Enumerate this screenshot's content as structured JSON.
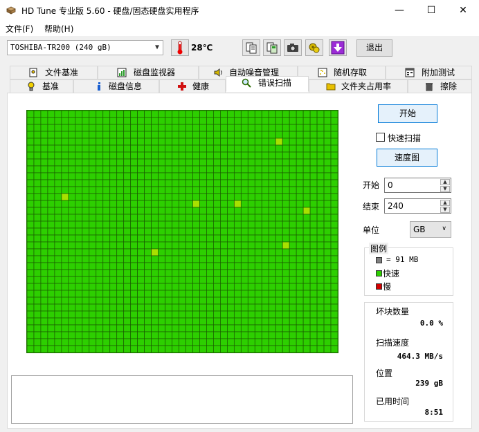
{
  "window": {
    "title": "HD Tune 专业版 5.60 - 硬盘/固态硬盘实用程序",
    "minimize_glyph": "—",
    "maximize_glyph": "☐",
    "close_glyph": "✕"
  },
  "menu": [
    {
      "label": "文件(F)"
    },
    {
      "label": "帮助(H)"
    }
  ],
  "toolbar": {
    "drive": "TOSHIBA-TR200 (240 gB)",
    "temperature": "28℃",
    "exit_label": "退出",
    "icons": [
      "copy-info-icon",
      "copy-all-icon",
      "screenshot-camera-icon",
      "options-icon",
      "download-icon"
    ]
  },
  "tabs_top": [
    {
      "label": "文件基准",
      "icon": "file-benchmark-icon"
    },
    {
      "label": "磁盘监视器",
      "icon": "disk-monitor-icon"
    },
    {
      "label": "自动噪音管理",
      "icon": "noise-speaker-icon"
    },
    {
      "label": "随机存取",
      "icon": "random-access-icon"
    },
    {
      "label": "附加测试",
      "icon": "extra-tests-icon"
    }
  ],
  "tabs_bottom": [
    {
      "label": "基准",
      "icon": "benchmark-icon"
    },
    {
      "label": "磁盘信息",
      "icon": "info-icon"
    },
    {
      "label": "健康",
      "icon": "health-cross-icon"
    },
    {
      "label": "错误扫描",
      "icon": "magnifier-icon",
      "active": true
    },
    {
      "label": "文件夹占用率",
      "icon": "folder-icon"
    },
    {
      "label": "擦除",
      "icon": "trash-icon"
    }
  ],
  "scan": {
    "grid_cols": 45,
    "grid_rows": 35,
    "fast_color": "#2dcf00",
    "slow_color": "#d40000",
    "light_blocks": [
      [
        36,
        4
      ],
      [
        5,
        12
      ],
      [
        24,
        13
      ],
      [
        30,
        13
      ],
      [
        40,
        14
      ],
      [
        37,
        19
      ],
      [
        18,
        20
      ]
    ]
  },
  "controls": {
    "start_button": "开始",
    "quick_scan_label": "快速扫描",
    "quick_scan_checked": false,
    "speed_map_button": "速度图",
    "start_label": "开始",
    "start_value": "0",
    "end_label": "结束",
    "end_value": "240",
    "unit_label": "单位",
    "unit_value": "GB"
  },
  "legend": {
    "title": "图例",
    "block_size": "= 91 MB",
    "block_color": "#808080",
    "fast_label": "快速",
    "fast_color": "#2dcf00",
    "slow_label": "慢",
    "slow_color": "#d40000"
  },
  "stats": {
    "bad_blocks_label": "坏块数量",
    "bad_blocks_value": "0.0 %",
    "scan_speed_label": "扫描速度",
    "scan_speed_value": "464.3 MB/s",
    "position_label": "位置",
    "position_value": "239 gB",
    "elapsed_label": "已用时间",
    "elapsed_value": "8:51"
  }
}
